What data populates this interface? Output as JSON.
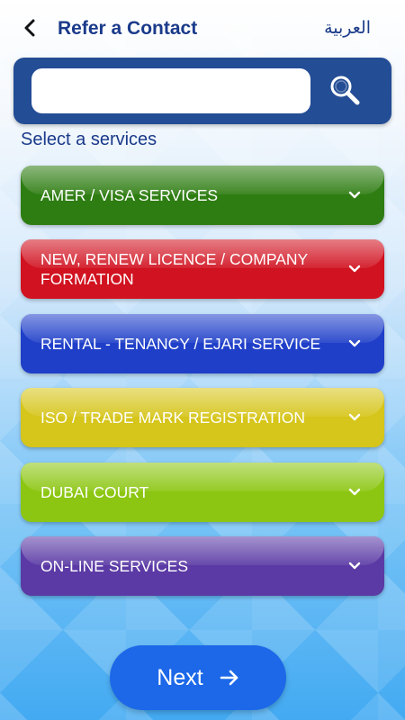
{
  "header": {
    "title": "Refer a Contact",
    "language_toggle": "العربية"
  },
  "search": {
    "placeholder": "",
    "value": ""
  },
  "section_label": "Select a services",
  "services": [
    {
      "label": "AMER /  VISA SERVICES",
      "color": "#2e7d12"
    },
    {
      "label": "NEW, RENEW  LICENCE / COMPANY FORMATION",
      "color": "#d11220"
    },
    {
      "label": "RENTAL - TENANCY / EJARI SERVICE",
      "color": "#1f3fc9"
    },
    {
      "label": "ISO / TRADE MARK REGISTRATION",
      "color": "#d6c51a"
    },
    {
      "label": "DUBAI COURT",
      "color": "#8cc612"
    },
    {
      "label": "ON-LINE SERVICES",
      "color": "#5b3aa5"
    }
  ],
  "next_button": {
    "label": "Next",
    "color": "#1c68e8"
  },
  "icons": {
    "back": "chevron-left-icon",
    "search": "search-icon",
    "expand": "chevron-down-icon",
    "next": "arrow-right-icon"
  }
}
